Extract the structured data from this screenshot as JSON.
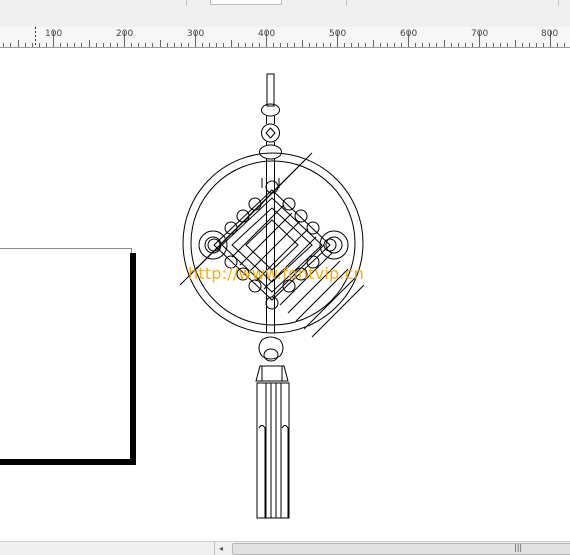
{
  "ruler": {
    "labels": [
      "100",
      "200",
      "300",
      "400",
      "500",
      "600",
      "700",
      "800"
    ]
  },
  "watermark": {
    "text": "http://www.fontvip.cn",
    "color": "#f2a900"
  },
  "drawing": {
    "subject": "chinese-knot-pendant",
    "stroke_color": "#000000"
  },
  "scrollbar": {
    "left_arrow_glyph": "◂",
    "grip_glyph": "|||"
  },
  "colors": {
    "toolbar_bg": "#f0f0f0",
    "ruler_bg": "#f7f7f7",
    "canvas_bg": "#ffffff",
    "page_shadow": "#000000"
  }
}
